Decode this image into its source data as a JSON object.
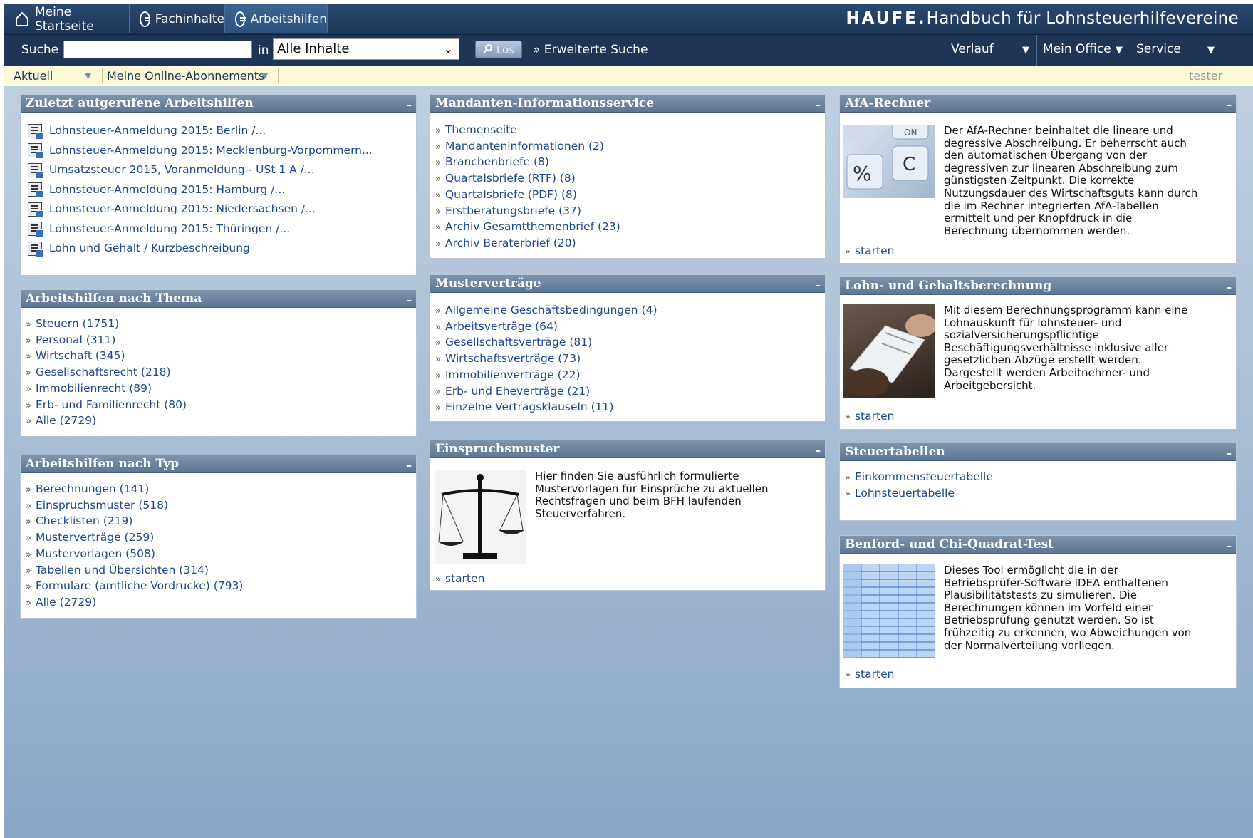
{
  "tabs": [
    {
      "label": "Meine Startseite",
      "icon": "home-icon"
    },
    {
      "label": "Fachinhalte",
      "icon": "menu-circle-icon"
    },
    {
      "label": "Arbeitshilfen",
      "icon": "menu-circle-icon",
      "active": true
    }
  ],
  "brand": {
    "logo": "HAUFE.",
    "title": "Handbuch für Lohnsteuerhilfevereine"
  },
  "search": {
    "label": "Suche",
    "value": "",
    "in_label": "in",
    "scope": "Alle Inhalte",
    "go_label": "Los",
    "advanced": "» Erweiterte Suche"
  },
  "menus": {
    "verlauf": "Verlauf",
    "office": "Mein Office",
    "service": "Service"
  },
  "subbar": {
    "aktuell": "Aktuell",
    "abos": "Meine Online-Abonnements",
    "user": "tester"
  },
  "recent": {
    "title": "Zuletzt aufgerufene Arbeitshilfen",
    "items": [
      "Lohnsteuer-Anmeldung 2015: Berlin /...",
      "Lohnsteuer-Anmeldung 2015: Mecklenburg-Vorpommern...",
      "Umsatzsteuer 2015, Voranmeldung - USt 1 A /...",
      "Lohnsteuer-Anmeldung 2015: Hamburg /...",
      "Lohnsteuer-Anmeldung 2015: Niedersachsen /...",
      "Lohnsteuer-Anmeldung 2015: Thüringen /...",
      "Lohn und Gehalt / Kurzbeschreibung"
    ]
  },
  "by_topic": {
    "title": "Arbeitshilfen nach Thema",
    "items": [
      "Steuern (1751)",
      "Personal (311)",
      "Wirtschaft (345)",
      "Gesellschaftsrecht (218)",
      "Immobilienrecht (89)",
      "Erb- und Familienrecht (80)",
      "Alle (2729)"
    ]
  },
  "by_type": {
    "title": "Arbeitshilfen nach Typ",
    "items": [
      "Berechnungen (141)",
      "Einspruchsmuster (518)",
      "Checklisten (219)",
      "Musterverträge (259)",
      "Mustervorlagen (508)",
      "Tabellen und Übersichten (314)",
      "Formulare (amtliche Vordrucke) (793)",
      "Alle (2729)"
    ]
  },
  "mandanten": {
    "title": "Mandanten-Informationsservice",
    "items": [
      "Themenseite",
      "Mandanteninformationen (2)",
      "Branchenbriefe (8)",
      "Quartalsbriefe (RTF) (8)",
      "Quartalsbriefe (PDF) (8)",
      "Erstberatungsbriefe (37)",
      "Archiv Gesamtthemenbrief (23)",
      "Archiv Beraterbrief (20)"
    ]
  },
  "vertraege": {
    "title": "Musterverträge",
    "items": [
      "Allgemeine Geschäftsbedingungen (4)",
      "Arbeitsverträge (64)",
      "Gesellschaftsverträge (81)",
      "Wirtschaftsverträge (73)",
      "Immobilienverträge (22)",
      "Erb- und Eheverträge (21)",
      "Einzelne Vertragsklauseln (11)"
    ]
  },
  "einspruch": {
    "title": "Einspruchsmuster",
    "text": [
      "Hier finden Sie ausführlich formulierte",
      "Mustervorlagen für Einsprüche zu aktuellen",
      "Rechtsfragen und beim BFH laufenden",
      "Steuerverfahren."
    ],
    "link": "starten"
  },
  "afa": {
    "title": "AfA-Rechner",
    "text": [
      "Der AfA-Rechner beinhaltet die lineare und",
      "degressive Abschreibung. Er beherrscht auch",
      "den automatischen Übergang von der",
      "degressiven zur linearen Abschreibung zum",
      "günstigsten Zeitpunkt. Die korrekte",
      "Nutzungsdauer des Wirtschaftsguts kann durch",
      "die im Rechner integrierten AfA-Tabellen",
      "ermittelt und per Knopfdruck in die",
      "Berechnung übernommen werden."
    ],
    "link": "starten"
  },
  "lohn": {
    "title": "Lohn- und Gehaltsberechnung",
    "text": [
      "Mit diesem Berechnungsprogramm kann eine",
      "Lohnauskunft für lohnsteuer- und",
      "sozialversicherungspflichtige",
      "Beschäftigungsverhältnisse inklusive aller",
      "gesetzlichen Abzüge erstellt werden.",
      "Dargestellt werden Arbeitnehmer- und",
      "Arbeitgebersicht."
    ],
    "link": "starten"
  },
  "steuertab": {
    "title": "Steuertabellen",
    "items": [
      "Einkommensteuertabelle",
      "Lohnsteuertabelle"
    ]
  },
  "benford": {
    "title": "Benford- und Chi-Quadrat-Test",
    "text": [
      "Dieses Tool ermöglicht die in der",
      "Betriebsprüfer-Software IDEA enthaltenen",
      "Plausibilitätstests zu simulieren. Die",
      "Berechnungen können im Vorfeld einer",
      "Betriebsprüfung genutzt werden. So ist",
      "frühzeitig zu erkennen, wo Abweichungen von",
      "der Normalverteilung vorliegen."
    ],
    "link": "starten"
  },
  "colors": {
    "nav": "#1d3656",
    "panel_head": "#6a829e",
    "link": "#20488a",
    "subbar": "#fdf9d6"
  }
}
